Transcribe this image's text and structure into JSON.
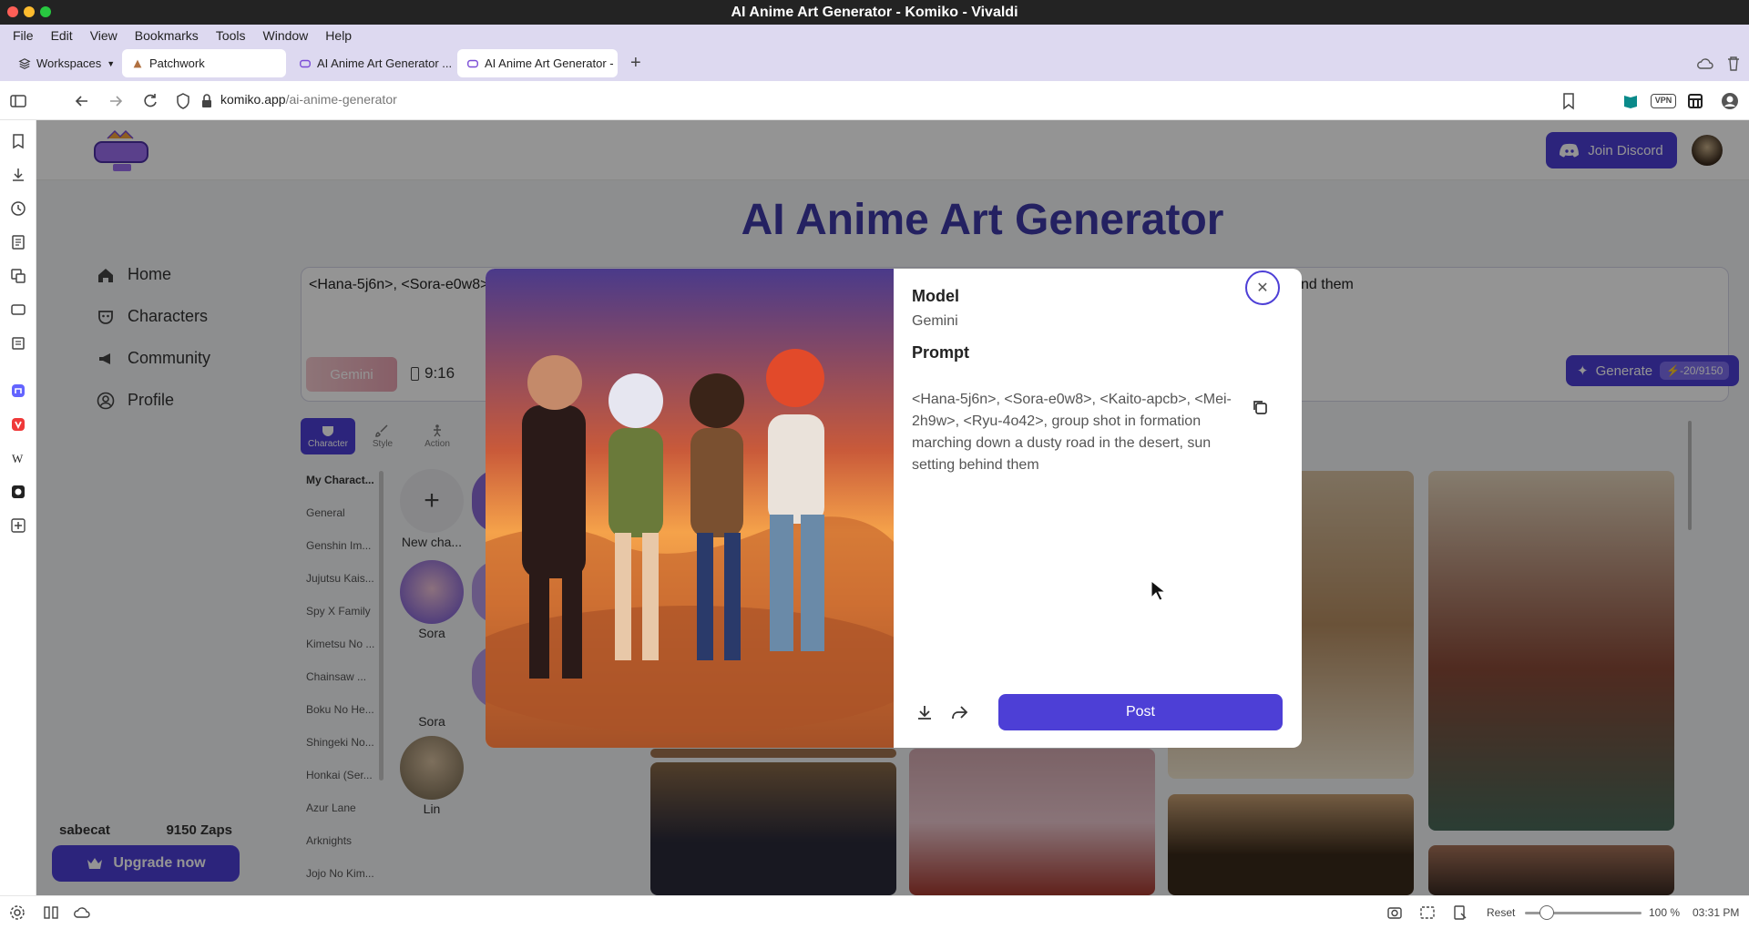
{
  "window": {
    "title": "AI Anime Art Generator - Komiko - Vivaldi"
  },
  "menu": [
    "File",
    "Edit",
    "View",
    "Bookmarks",
    "Tools",
    "Window",
    "Help"
  ],
  "tabs": {
    "workspaces": "Workspaces",
    "items": [
      {
        "label": "Patchwork"
      },
      {
        "label": "AI Anime Art Generator ..."
      },
      {
        "label": "AI Anime Art Generator - K"
      }
    ]
  },
  "address": {
    "domain": "komiko.app",
    "path": "/ai-anime-generator"
  },
  "page": {
    "title": "AI Anime Art Generator",
    "join_discord": "Join Discord",
    "nav": [
      "Home",
      "Characters",
      "Community",
      "Profile"
    ],
    "user": {
      "name": "sabecat",
      "zaps": "9150 Zaps"
    },
    "upgrade": "Upgrade now",
    "prompt_left": "<Hana-5j6n>, <Sora-e0w8>",
    "prompt_right": "nd them",
    "model_chip": "Gemini",
    "ratio": "9:16",
    "generate": {
      "label": "Generate",
      "cost": "-20/9150"
    },
    "char_tabs": [
      "Character",
      "Style",
      "Action"
    ],
    "categories": [
      "My Charact...",
      "General",
      "Genshin Im...",
      "Jujutsu Kais...",
      "Spy X Family",
      "Kimetsu No ...",
      "Chainsaw ...",
      "Boku No He...",
      "Shingeki No...",
      "Honkai (Ser...",
      "Azur Lane",
      "Arknights",
      "Jojo No Kim..."
    ],
    "characters": {
      "new": "New cha...",
      "c1": "Sora",
      "c2": "Sora",
      "c3": "Lin"
    }
  },
  "modal": {
    "model_label": "Model",
    "model_value": "Gemini",
    "prompt_label": "Prompt",
    "prompt_value": "<Hana-5j6n>, <Sora-e0w8>, <Kaito-apcb>, <Mei-2h9w>, <Ryu-4o42>, group shot in formation marching down a dusty road in the desert, sun setting behind them",
    "post": "Post"
  },
  "status": {
    "reset": "Reset",
    "zoom": "100 %",
    "time": "03:31 PM"
  },
  "colors": {
    "accent": "#4d3fd6",
    "title": "#3f3aa8",
    "chrome": "#ddd9f0"
  }
}
